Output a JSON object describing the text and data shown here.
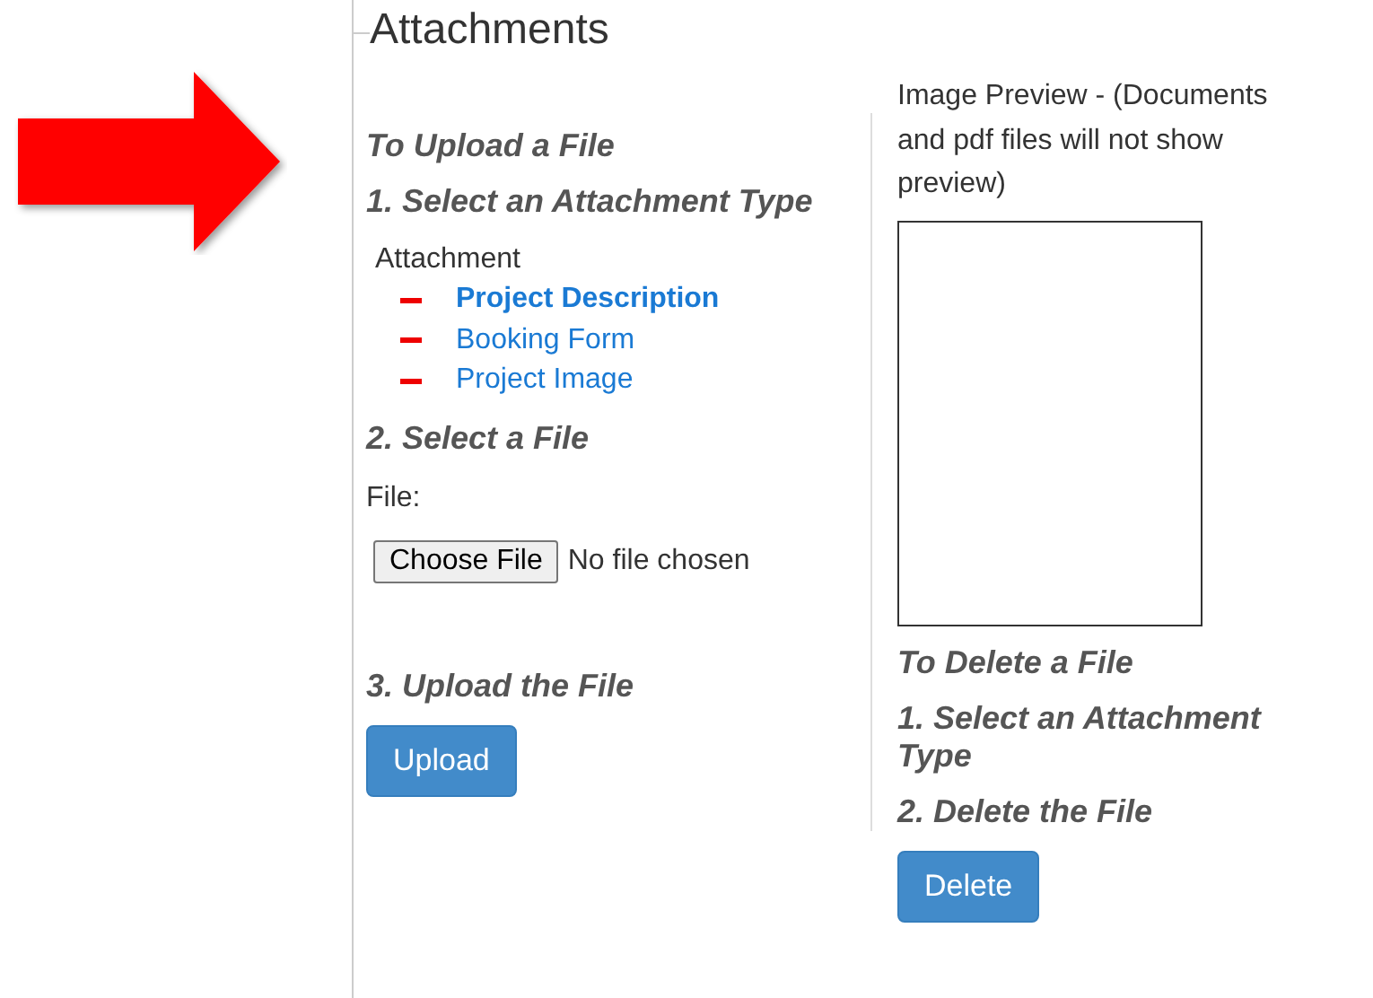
{
  "legend": "Attachments",
  "upload": {
    "heading": "To Upload a File",
    "step_1": "1. Select an Attachment Type",
    "list_label": "Attachment",
    "attachment_types": [
      {
        "label": "Project Description",
        "selected": true
      },
      {
        "label": "Booking Form",
        "selected": false
      },
      {
        "label": "Project Image",
        "selected": false
      }
    ],
    "step_2": "2. Select a File",
    "file_label": "File:",
    "file_button": "Choose File",
    "file_status": "No file chosen",
    "step_3": "3. Upload the File",
    "upload_button": "Upload"
  },
  "preview": {
    "caption": "Image Preview - (Documents and pdf files will not show preview)"
  },
  "delete": {
    "heading": "To Delete a File",
    "step_1": "1. Select an Attachment Type",
    "step_2": "2. Delete the File",
    "delete_button": "Delete"
  }
}
